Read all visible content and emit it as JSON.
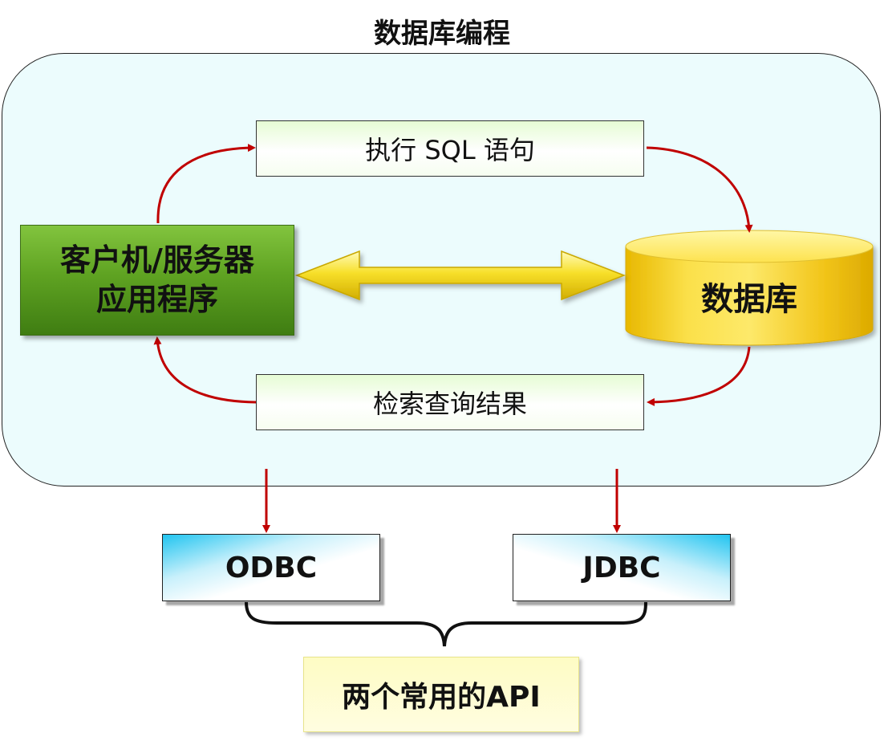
{
  "title": "数据库编程",
  "client_app": {
    "line1": "客户机/服务器",
    "line2": "应用程序"
  },
  "database": {
    "label": "数据库"
  },
  "steps": {
    "execute_sql": "执行 SQL 语句",
    "query_results": "检索查询结果"
  },
  "apis": {
    "odbc": "ODBC",
    "jdbc": "JDBC",
    "summary": "两个常用的API"
  },
  "colors": {
    "frame_fill": "#ecfcfd",
    "client_green": "#5fa322",
    "database_yellow": "#f3cf10",
    "arrow_red": "#c00000",
    "api_blue": "#21c4f0",
    "note_yellow": "#fefcc4"
  }
}
